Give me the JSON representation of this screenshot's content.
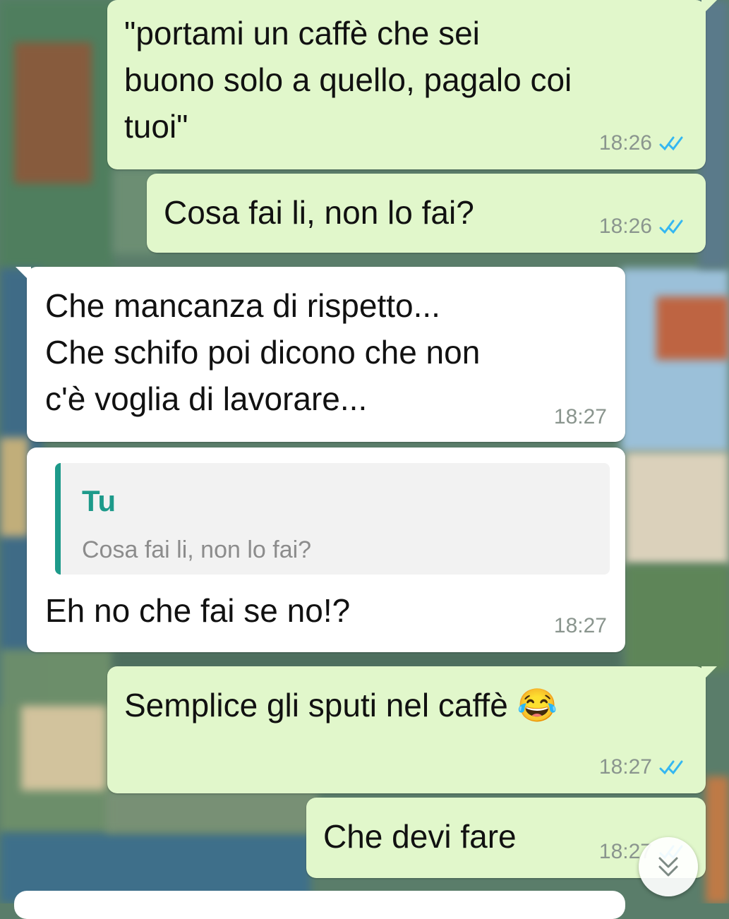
{
  "messages": [
    {
      "direction": "outgoing",
      "text_lines": [
        "\"portami un caffè che sei",
        "buono solo a quello, pagalo coi",
        "tuoi\""
      ],
      "time": "18:26",
      "status": "read"
    },
    {
      "direction": "outgoing",
      "text_lines": [
        "Cosa fai li, non lo fai?"
      ],
      "time": "18:26",
      "status": "read"
    },
    {
      "direction": "incoming",
      "text_lines": [
        "Che mancanza di rispetto...",
        "Che schifo poi dicono che non",
        "c'è voglia di lavorare..."
      ],
      "time": "18:27"
    },
    {
      "direction": "incoming",
      "quote": {
        "author": "Tu",
        "text": "Cosa fai li, non lo fai?"
      },
      "text_lines": [
        "Eh no che fai se no!?"
      ],
      "time": "18:27"
    },
    {
      "direction": "outgoing",
      "text_lines": [
        "Semplice gli sputi nel caffè 😂"
      ],
      "time": "18:27",
      "status": "read"
    },
    {
      "direction": "outgoing",
      "text_lines": [
        "Che devi fare"
      ],
      "time": "18:27",
      "status": "read"
    }
  ],
  "scroll_button": {
    "icon": "double-chevron-down-icon"
  },
  "colors": {
    "outgoing_bubble": "#e1f7cb",
    "incoming_bubble": "#ffffff",
    "read_ticks": "#34b7f1",
    "quote_accent": "#1d9a8a"
  }
}
